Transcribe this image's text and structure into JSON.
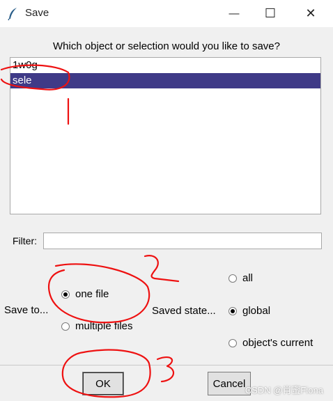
{
  "window": {
    "title": "Save",
    "icon": "feather-icon"
  },
  "controls": {
    "minimize": "—",
    "maximize": "☐",
    "close": "✕"
  },
  "prompt": "Which object or selection would you like to save?",
  "list": {
    "items": [
      "1w0g",
      "sele"
    ],
    "selected_index": 1
  },
  "filter": {
    "label": "Filter:",
    "value": ""
  },
  "save_to": {
    "label": "Save to...",
    "options": [
      "one file",
      "multiple files"
    ],
    "selected": "one file"
  },
  "saved_state": {
    "label": "Saved state...",
    "options": [
      "all",
      "global",
      "object's current"
    ],
    "selected": "global"
  },
  "buttons": {
    "ok": "OK",
    "cancel": "Cancel"
  },
  "watermark": "CSDN @肖蜜Fiona",
  "annotations": {
    "marks": [
      "1",
      "2",
      "3"
    ],
    "color": "#ee1111"
  },
  "colors": {
    "selection": "#3f3a87"
  }
}
